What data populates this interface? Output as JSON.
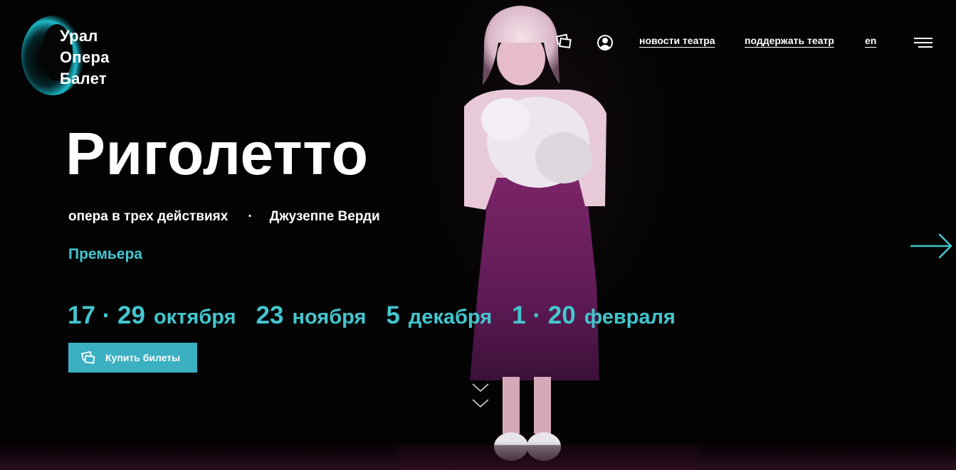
{
  "brand": {
    "lines": [
      "Урал",
      "Опера",
      "Балет"
    ],
    "accent_color": "#43c6cf"
  },
  "nav": {
    "tickets_icon": "tickets-icon",
    "account_icon": "user-circle-icon",
    "news_label": "новости театра",
    "support_label": "поддержать театр",
    "lang_label": "en",
    "menu_icon": "hamburger-menu-icon"
  },
  "hero": {
    "title": "Риголетто",
    "genre": "опера в трех действиях",
    "separator": "·",
    "composer": "Джузеппе Верди",
    "badge": "Премьера",
    "dates": [
      {
        "days": "17 · 29",
        "month": "октября"
      },
      {
        "days": "23",
        "month": "ноября"
      },
      {
        "days": "5",
        "month": "декабря"
      },
      {
        "days": "1 · 20",
        "month": "февраля"
      }
    ],
    "buy_label": "Купить билеты",
    "next_icon": "arrow-right-icon",
    "scroll_icon": "double-chevron-down-icon"
  }
}
